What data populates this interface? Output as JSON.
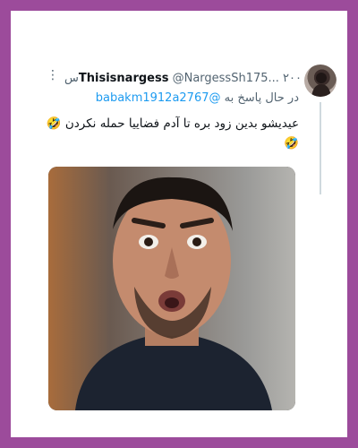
{
  "tweet": {
    "display_name": "Thisisnargess",
    "handle": "@NargessSh175...",
    "time": "۲۰۰س",
    "more_icon": "more-horizontal-icon",
    "reply_label": "در حال پاسخ به",
    "reply_mention": "@babakm1912a2767",
    "body": "عیدیشو بدین زود بره تا آدم فضاییا حمله نکردن 🤣🤣"
  },
  "colors": {
    "frame": "#9c4b9b",
    "link": "#1d9bf0",
    "secondary_text": "#536471"
  }
}
